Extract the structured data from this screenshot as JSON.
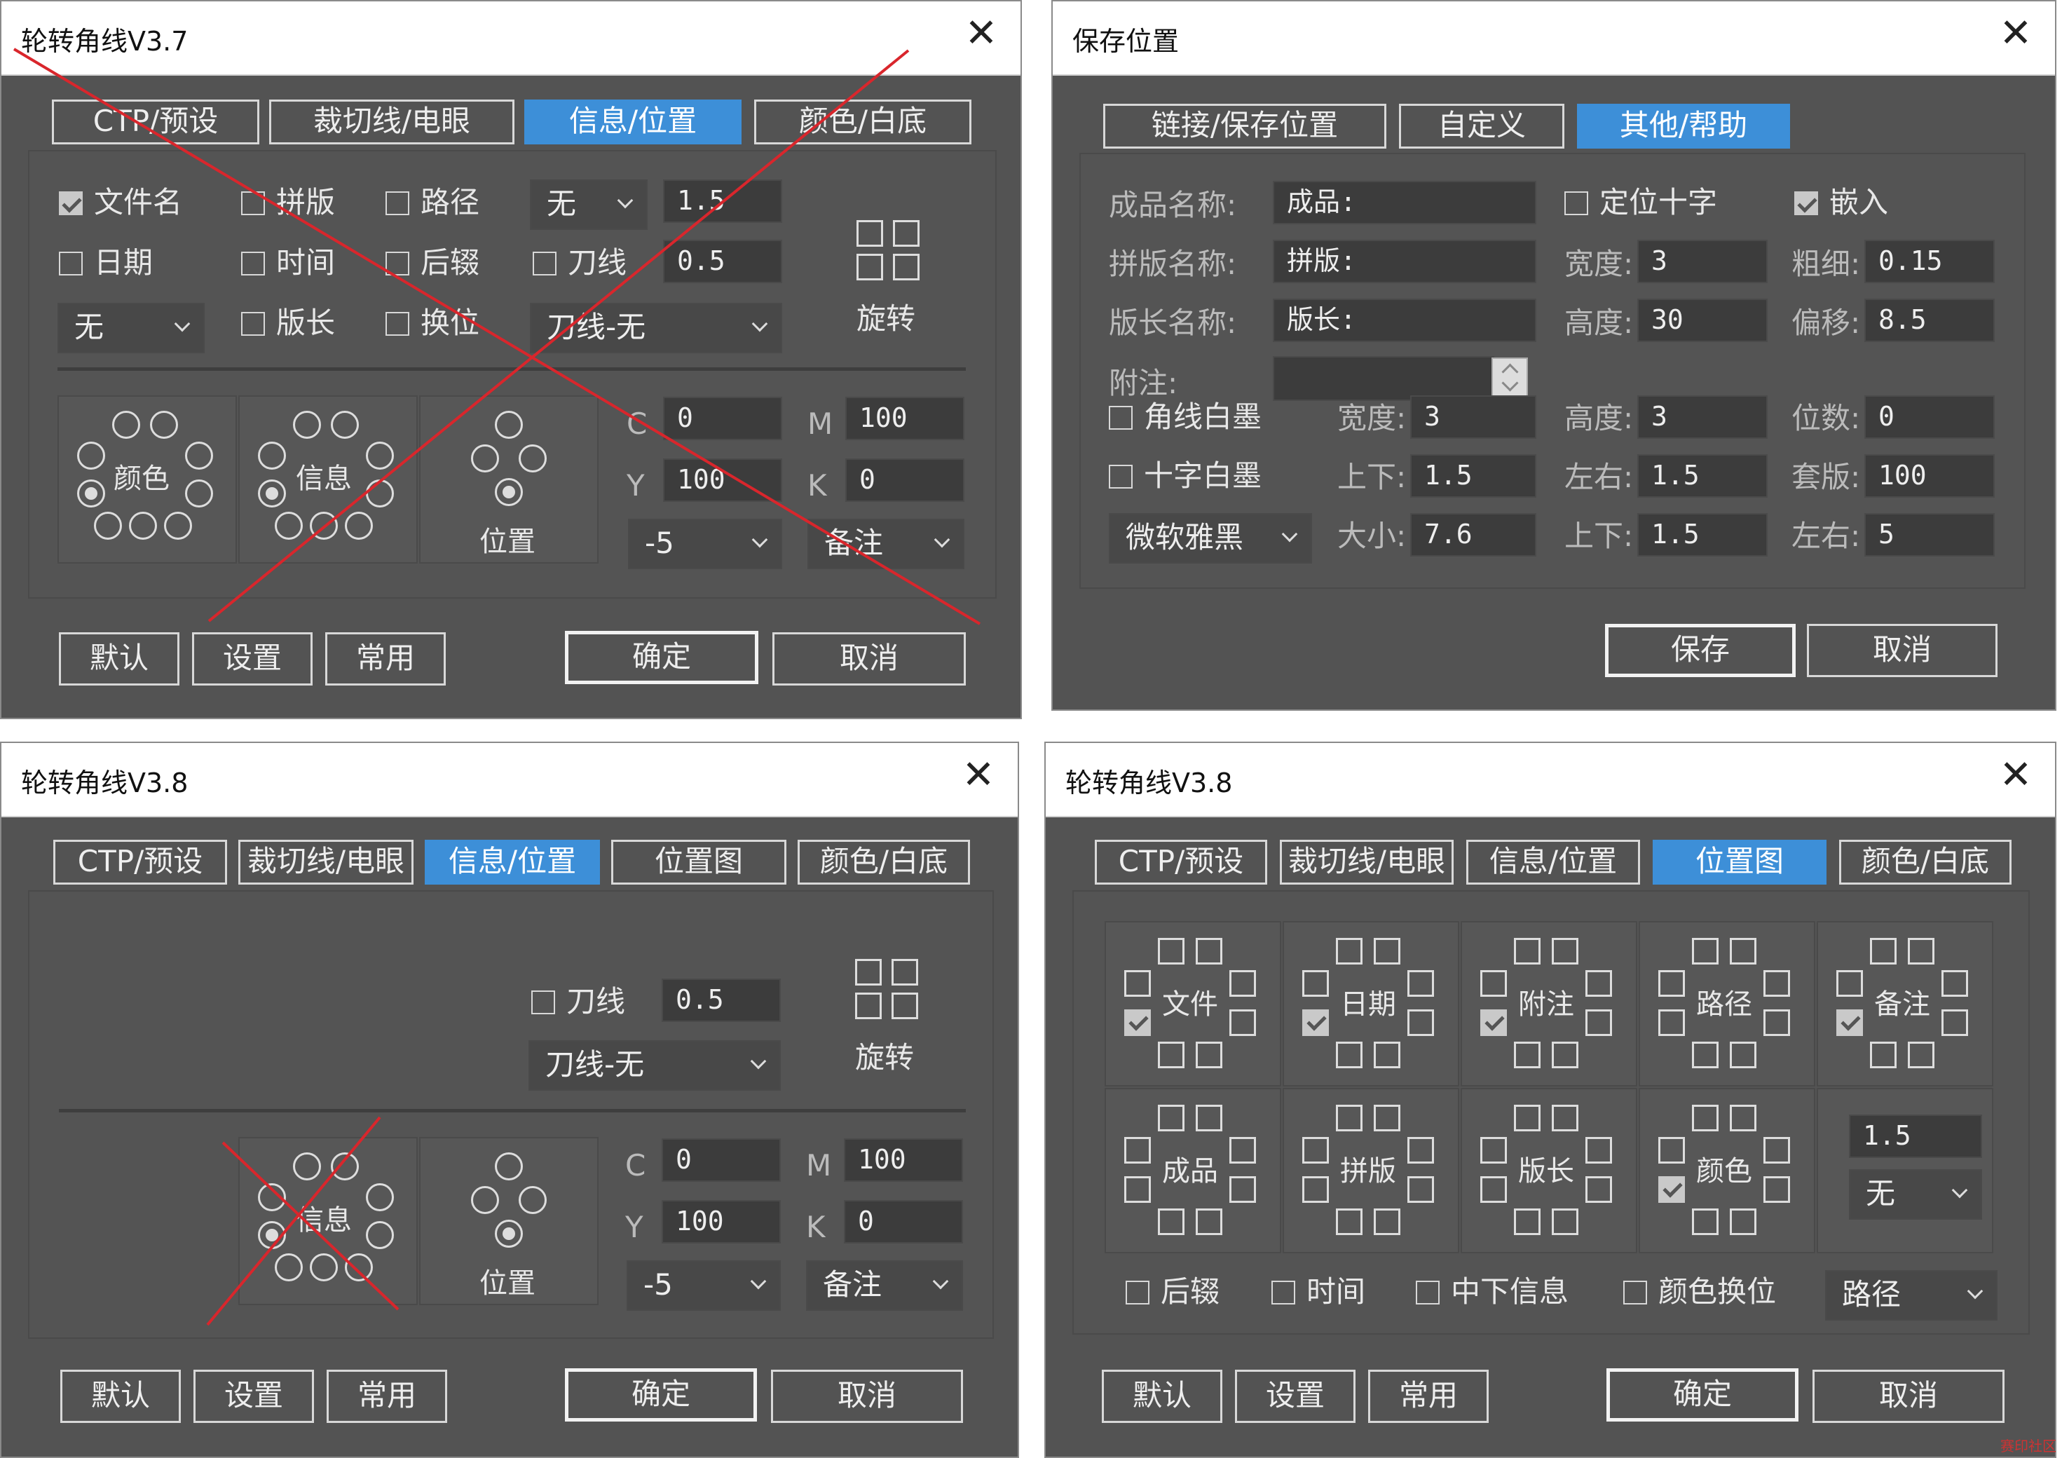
{
  "d1": {
    "title": "轮转角线V3.7",
    "tabs": [
      "CTP/预设",
      "裁切线/电眼",
      "信息/位置",
      "颜色/白底"
    ],
    "active_tab": 2,
    "checks": {
      "filename": {
        "label": "文件名",
        "checked": true
      },
      "imposition": {
        "label": "拼版",
        "checked": false
      },
      "path": {
        "label": "路径",
        "checked": false
      },
      "date": {
        "label": "日期",
        "checked": false
      },
      "time": {
        "label": "时间",
        "checked": false
      },
      "suffix": {
        "label": "后辍",
        "checked": false
      },
      "cutline": {
        "label": "刀线",
        "checked": false
      },
      "length": {
        "label": "版长",
        "checked": false
      },
      "swap": {
        "label": "换位",
        "checked": false
      }
    },
    "select_none_top": "无",
    "input_size": "1.5",
    "input_cut": "0.5",
    "select_none_left": "无",
    "select_cut": "刀线-无",
    "rotate_label": "旋转",
    "pos_labels": {
      "color": "颜色",
      "info": "信息",
      "position": "位置"
    },
    "cmyk": {
      "c_label": "C",
      "c": "0",
      "m_label": "M",
      "m": "100",
      "y_label": "Y",
      "y": "100",
      "k_label": "K",
      "k": "0"
    },
    "select_offset": "-5",
    "select_note": "备注",
    "buttons": {
      "default": "默认",
      "settings": "设置",
      "common": "常用",
      "ok": "确定",
      "cancel": "取消"
    }
  },
  "d2": {
    "title": "保存位置",
    "tabs": [
      "链接/保存位置",
      "自定义",
      "其他/帮助"
    ],
    "active_tab": 2,
    "product_name_label": "成品名称:",
    "product_name": "成品:",
    "imposition_name_label": "拼版名称:",
    "imposition_name": "拼版:",
    "length_name_label": "版长名称:",
    "length_name": "版长:",
    "note_label": "附注:",
    "note": "",
    "cross": {
      "label": "定位十字",
      "checked": false
    },
    "embed": {
      "label": "嵌入",
      "checked": true
    },
    "width_label": "宽度:",
    "width": "3",
    "thick_label": "粗细:",
    "thick": "0.15",
    "height_label": "高度:",
    "height": "30",
    "offset_label": "偏移:",
    "offset": "8.5",
    "corner_white": {
      "label": "角线白墨",
      "checked": false
    },
    "cw_width_label": "宽度:",
    "cw_width": "3",
    "cw_height_label": "高度:",
    "cw_height": "3",
    "digits_label": "位数:",
    "digits": "0",
    "cross_white": {
      "label": "十字白墨",
      "checked": false
    },
    "ud_label": "上下:",
    "ud": "1.5",
    "lr_label": "左右:",
    "lr": "1.5",
    "reg_label": "套版:",
    "reg": "100",
    "font_select": "微软雅黑",
    "size_label": "大小:",
    "size": "7.6",
    "ud2_label": "上下:",
    "ud2": "1.5",
    "lr2_label": "左右:",
    "lr2": "5",
    "buttons": {
      "save": "保存",
      "cancel": "取消"
    }
  },
  "d3": {
    "title": "轮转角线V3.8",
    "tabs": [
      "CTP/预设",
      "裁切线/电眼",
      "信息/位置",
      "位置图",
      "颜色/白底"
    ],
    "active_tab": 2,
    "cutline": {
      "label": "刀线",
      "checked": false
    },
    "input_cut": "0.5",
    "select_cut": "刀线-无",
    "rotate_label": "旋转",
    "pos_labels": {
      "info": "信息",
      "position": "位置"
    },
    "cmyk": {
      "c_label": "C",
      "c": "0",
      "m_label": "M",
      "m": "100",
      "y_label": "Y",
      "y": "100",
      "k_label": "K",
      "k": "0"
    },
    "select_offset": "-5",
    "select_note": "备注",
    "buttons": {
      "default": "默认",
      "settings": "设置",
      "common": "常用",
      "ok": "确定",
      "cancel": "取消"
    }
  },
  "d4": {
    "title": "轮转角线V3.8",
    "tabs": [
      "CTP/预设",
      "裁切线/电眼",
      "信息/位置",
      "位置图",
      "颜色/白底"
    ],
    "active_tab": 3,
    "cells_row1": [
      "文件",
      "日期",
      "附注",
      "路径",
      "备注"
    ],
    "cells_row1_checked": [
      true,
      true,
      true,
      false,
      true
    ],
    "cells_row2": [
      "成品",
      "拼版",
      "版长",
      "颜色"
    ],
    "cells_row2_checked": [
      false,
      false,
      false,
      true
    ],
    "input_size": "1.5",
    "select_none": "无",
    "opts": {
      "suffix": "后辍",
      "time": "时间",
      "mid_info": "中下信息",
      "color_swap": "颜色换位"
    },
    "select_path": "路径",
    "buttons": {
      "default": "默认",
      "settings": "设置",
      "common": "常用",
      "ok": "确定",
      "cancel": "取消"
    }
  },
  "colors": {
    "panel": "#535353",
    "accent": "#3d8fd8",
    "strike": "#d9262c"
  },
  "watermark": "赛印社区"
}
